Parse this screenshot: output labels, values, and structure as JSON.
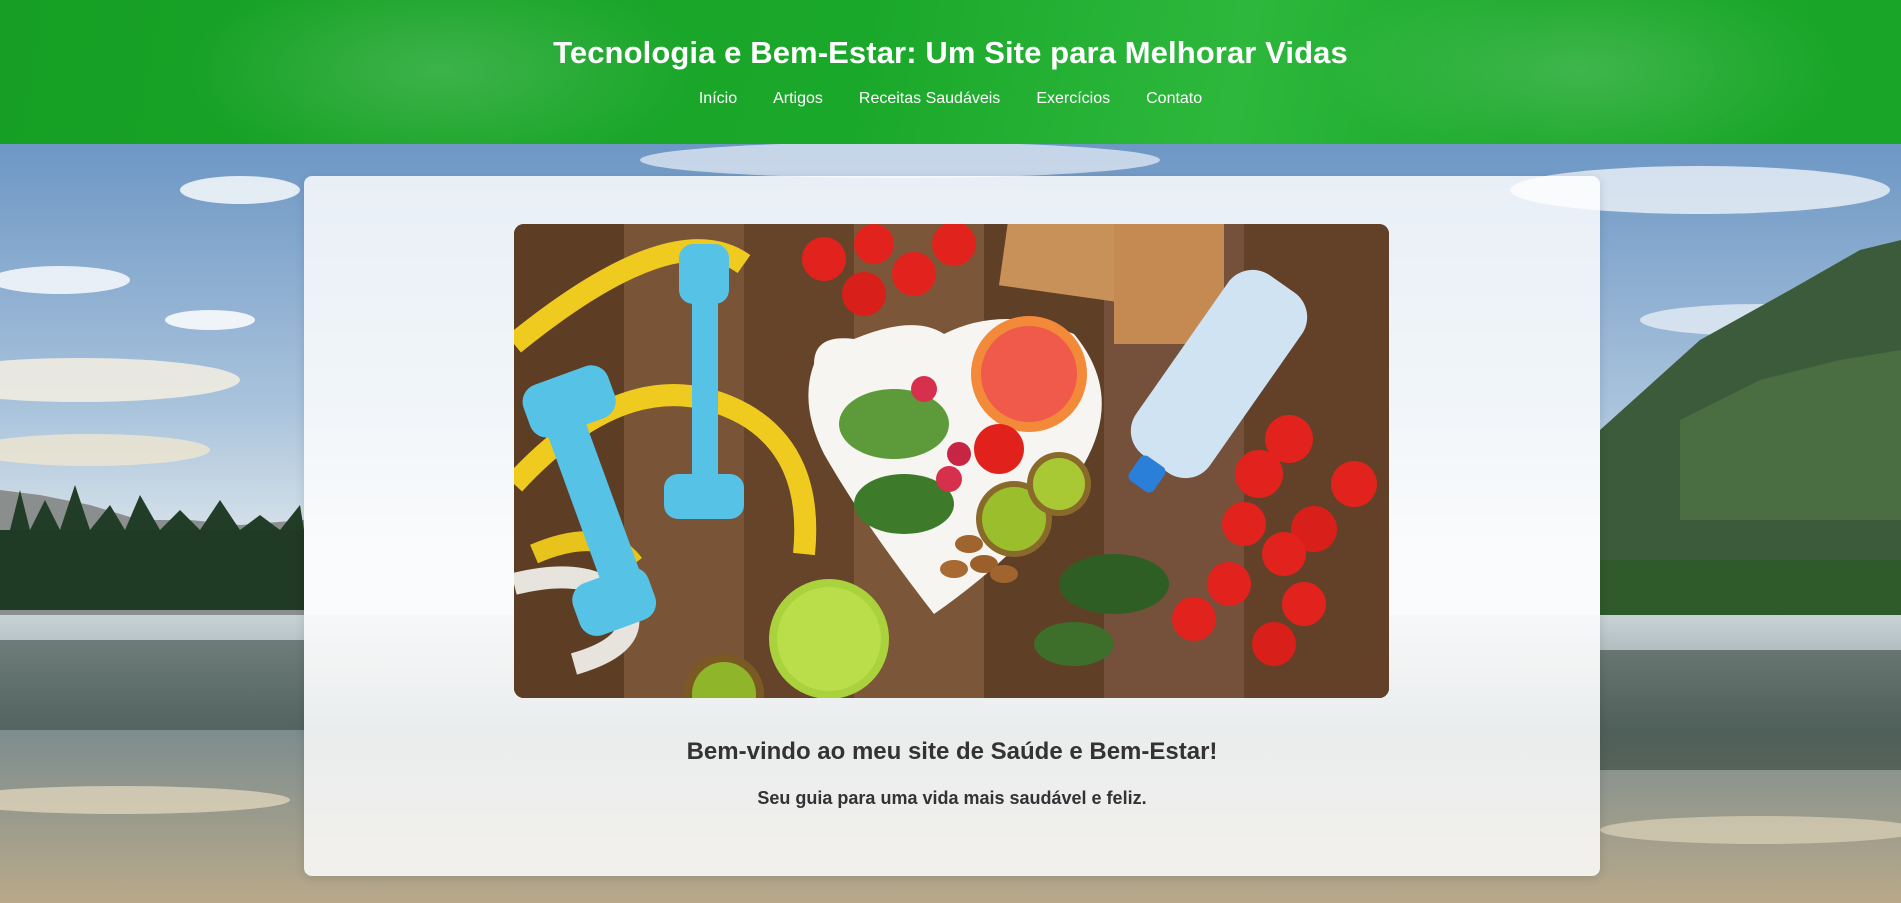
{
  "header": {
    "title": "Tecnologia e Bem-Estar: Um Site para Melhorar Vidas",
    "nav": [
      {
        "label": "Início"
      },
      {
        "label": "Artigos"
      },
      {
        "label": "Receitas Saudáveis"
      },
      {
        "label": "Exercícios"
      },
      {
        "label": "Contato"
      }
    ]
  },
  "main": {
    "welcome_heading": "Bem-vindo ao meu site de Saúde e Bem-Estar!",
    "tagline": "Seu guia para uma vida mais saudável e feliz."
  },
  "colors": {
    "header_green": "#1aa82a",
    "text_dark": "#333333"
  }
}
